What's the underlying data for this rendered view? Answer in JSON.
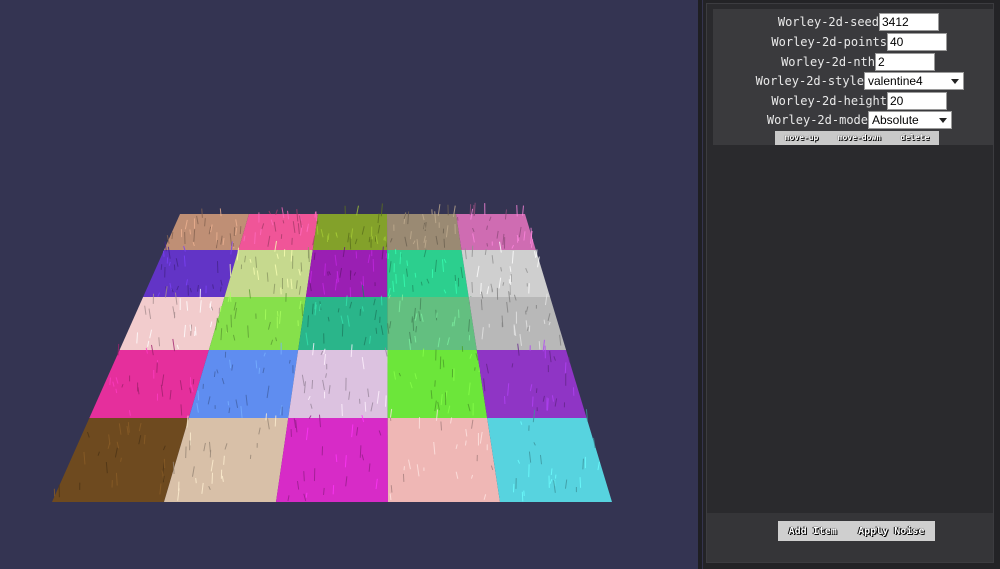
{
  "viewport": {
    "background": "#343452",
    "tile_colors": [
      [
        "#bf8f75",
        "#f05598",
        "#83a12a",
        "#9a8a73",
        "#cf6cb2"
      ],
      [
        "#6234c6",
        "#c6d98e",
        "#9a1fb3",
        "#2ccf8e",
        "#cfcfcf"
      ],
      [
        "#f2cccd",
        "#86e04b",
        "#2ab58a",
        "#63bf80",
        "#b8b8b8"
      ],
      [
        "#e52f9c",
        "#5f8df0",
        "#dcc2e0",
        "#6ce63a",
        "#8f35c5"
      ],
      [
        "#6e4a1f",
        "#d8c0a8",
        "#d72bc7",
        "#efb7b5",
        "#57d3df"
      ]
    ]
  },
  "panel": {
    "fields": [
      {
        "label": "Worley-2d-seed",
        "value": "3412",
        "kind": "input"
      },
      {
        "label": "Worley-2d-points",
        "value": "40",
        "kind": "input"
      },
      {
        "label": "Worley-2d-nth",
        "value": "2",
        "kind": "input"
      },
      {
        "label": "Worley-2d-style",
        "value": "valentine4",
        "kind": "select"
      },
      {
        "label": "Worley-2d-height",
        "value": "20",
        "kind": "input"
      },
      {
        "label": "Worley-2d-mode",
        "value": "Absolute",
        "kind": "select"
      }
    ],
    "item_buttons": {
      "move_up": "move-up",
      "move_down": "move-down",
      "delete": "delete"
    },
    "footer": {
      "add_item": "Add Item",
      "apply_noise": "Apply Noise"
    }
  }
}
